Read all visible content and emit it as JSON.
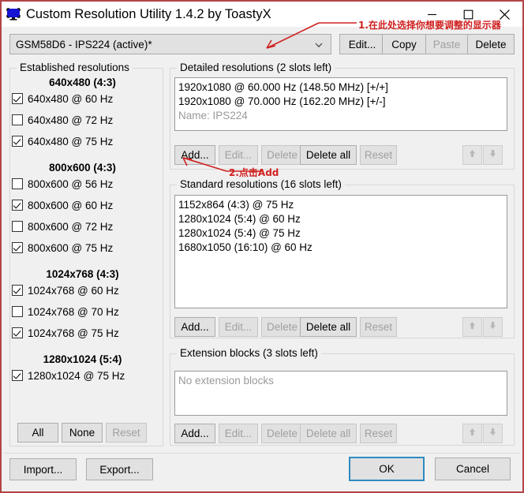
{
  "window": {
    "title": "Custom Resolution Utility 1.4.2 by ToastyX",
    "app_icon": "monitor-icon",
    "minimize_label": "Minimize",
    "maximize_label": "Maximize",
    "close_label": "Close",
    "border_color": "#b24545"
  },
  "monitor_select": {
    "value": "GSM58D6 - IPS224 (active)*",
    "dropdown_icon": "chevron-down-icon",
    "buttons": [
      {
        "label": "Edit...",
        "enabled": true
      },
      {
        "label": "Copy",
        "enabled": true
      },
      {
        "label": "Paste",
        "enabled": false
      },
      {
        "label": "Delete",
        "enabled": true
      }
    ]
  },
  "established": {
    "title": "Established resolutions",
    "groups": [
      {
        "heading": "640x480 (4:3)",
        "items": [
          {
            "label": "640x480 @ 60 Hz",
            "checked": true
          },
          {
            "label": "640x480 @ 72 Hz",
            "checked": false
          },
          {
            "label": "640x480 @ 75 Hz",
            "checked": true
          }
        ]
      },
      {
        "heading": "800x600 (4:3)",
        "items": [
          {
            "label": "800x600 @ 56 Hz",
            "checked": false
          },
          {
            "label": "800x600 @ 60 Hz",
            "checked": true
          },
          {
            "label": "800x600 @ 72 Hz",
            "checked": false
          },
          {
            "label": "800x600 @ 75 Hz",
            "checked": true
          }
        ]
      },
      {
        "heading": "1024x768 (4:3)",
        "items": [
          {
            "label": "1024x768 @ 60 Hz",
            "checked": true
          },
          {
            "label": "1024x768 @ 70 Hz",
            "checked": false
          },
          {
            "label": "1024x768 @ 75 Hz",
            "checked": true
          }
        ]
      },
      {
        "heading": "1280x1024 (5:4)",
        "items": [
          {
            "label": "1280x1024 @ 75 Hz",
            "checked": true
          }
        ]
      }
    ],
    "buttons": [
      {
        "label": "All",
        "enabled": true
      },
      {
        "label": "None",
        "enabled": true
      },
      {
        "label": "Reset",
        "enabled": false
      }
    ]
  },
  "detailed": {
    "title": "Detailed resolutions (2 slots left)",
    "lines": [
      {
        "text": "1920x1080 @ 60.000 Hz (148.50 MHz) [+/+]",
        "dim": false
      },
      {
        "text": "1920x1080 @ 70.000 Hz (162.20 MHz) [+/-]",
        "dim": false
      },
      {
        "text": "Name: IPS224",
        "dim": true
      }
    ],
    "buttons": [
      {
        "label": "Add...",
        "enabled": true
      },
      {
        "label": "Edit...",
        "enabled": false
      },
      {
        "label": "Delete",
        "enabled": false
      },
      {
        "label": "Delete all",
        "enabled": true
      },
      {
        "label": "Reset",
        "enabled": false
      }
    ],
    "move_up_icon": "arrow-up-icon",
    "move_down_icon": "arrow-down-icon"
  },
  "standard": {
    "title": "Standard resolutions (16 slots left)",
    "lines": [
      {
        "text": "1152x864 (4:3) @ 75 Hz",
        "dim": false
      },
      {
        "text": "1280x1024 (5:4) @ 60 Hz",
        "dim": false
      },
      {
        "text": "1280x1024 (5:4) @ 75 Hz",
        "dim": false
      },
      {
        "text": "1680x1050 (16:10) @ 60 Hz",
        "dim": false
      }
    ],
    "buttons": [
      {
        "label": "Add...",
        "enabled": true
      },
      {
        "label": "Edit...",
        "enabled": false
      },
      {
        "label": "Delete",
        "enabled": false
      },
      {
        "label": "Delete all",
        "enabled": true
      },
      {
        "label": "Reset",
        "enabled": false
      }
    ],
    "move_up_icon": "arrow-up-icon",
    "move_down_icon": "arrow-down-icon"
  },
  "extension": {
    "title": "Extension blocks (3 slots left)",
    "lines": [
      {
        "text": "No extension blocks",
        "dim": true
      }
    ],
    "buttons": [
      {
        "label": "Add...",
        "enabled": true
      },
      {
        "label": "Edit...",
        "enabled": false
      },
      {
        "label": "Delete",
        "enabled": false
      },
      {
        "label": "Delete all",
        "enabled": false
      },
      {
        "label": "Reset",
        "enabled": false
      }
    ],
    "move_up_icon": "arrow-up-icon",
    "move_down_icon": "arrow-down-icon"
  },
  "footer": {
    "import_label": "Import...",
    "export_label": "Export...",
    "ok_label": "OK",
    "cancel_label": "Cancel"
  },
  "annotations": [
    {
      "text": "1.在此处选择你想要调整的显示器",
      "color": "#d02020"
    },
    {
      "text": "2.点击Add",
      "color": "#d02020"
    }
  ]
}
